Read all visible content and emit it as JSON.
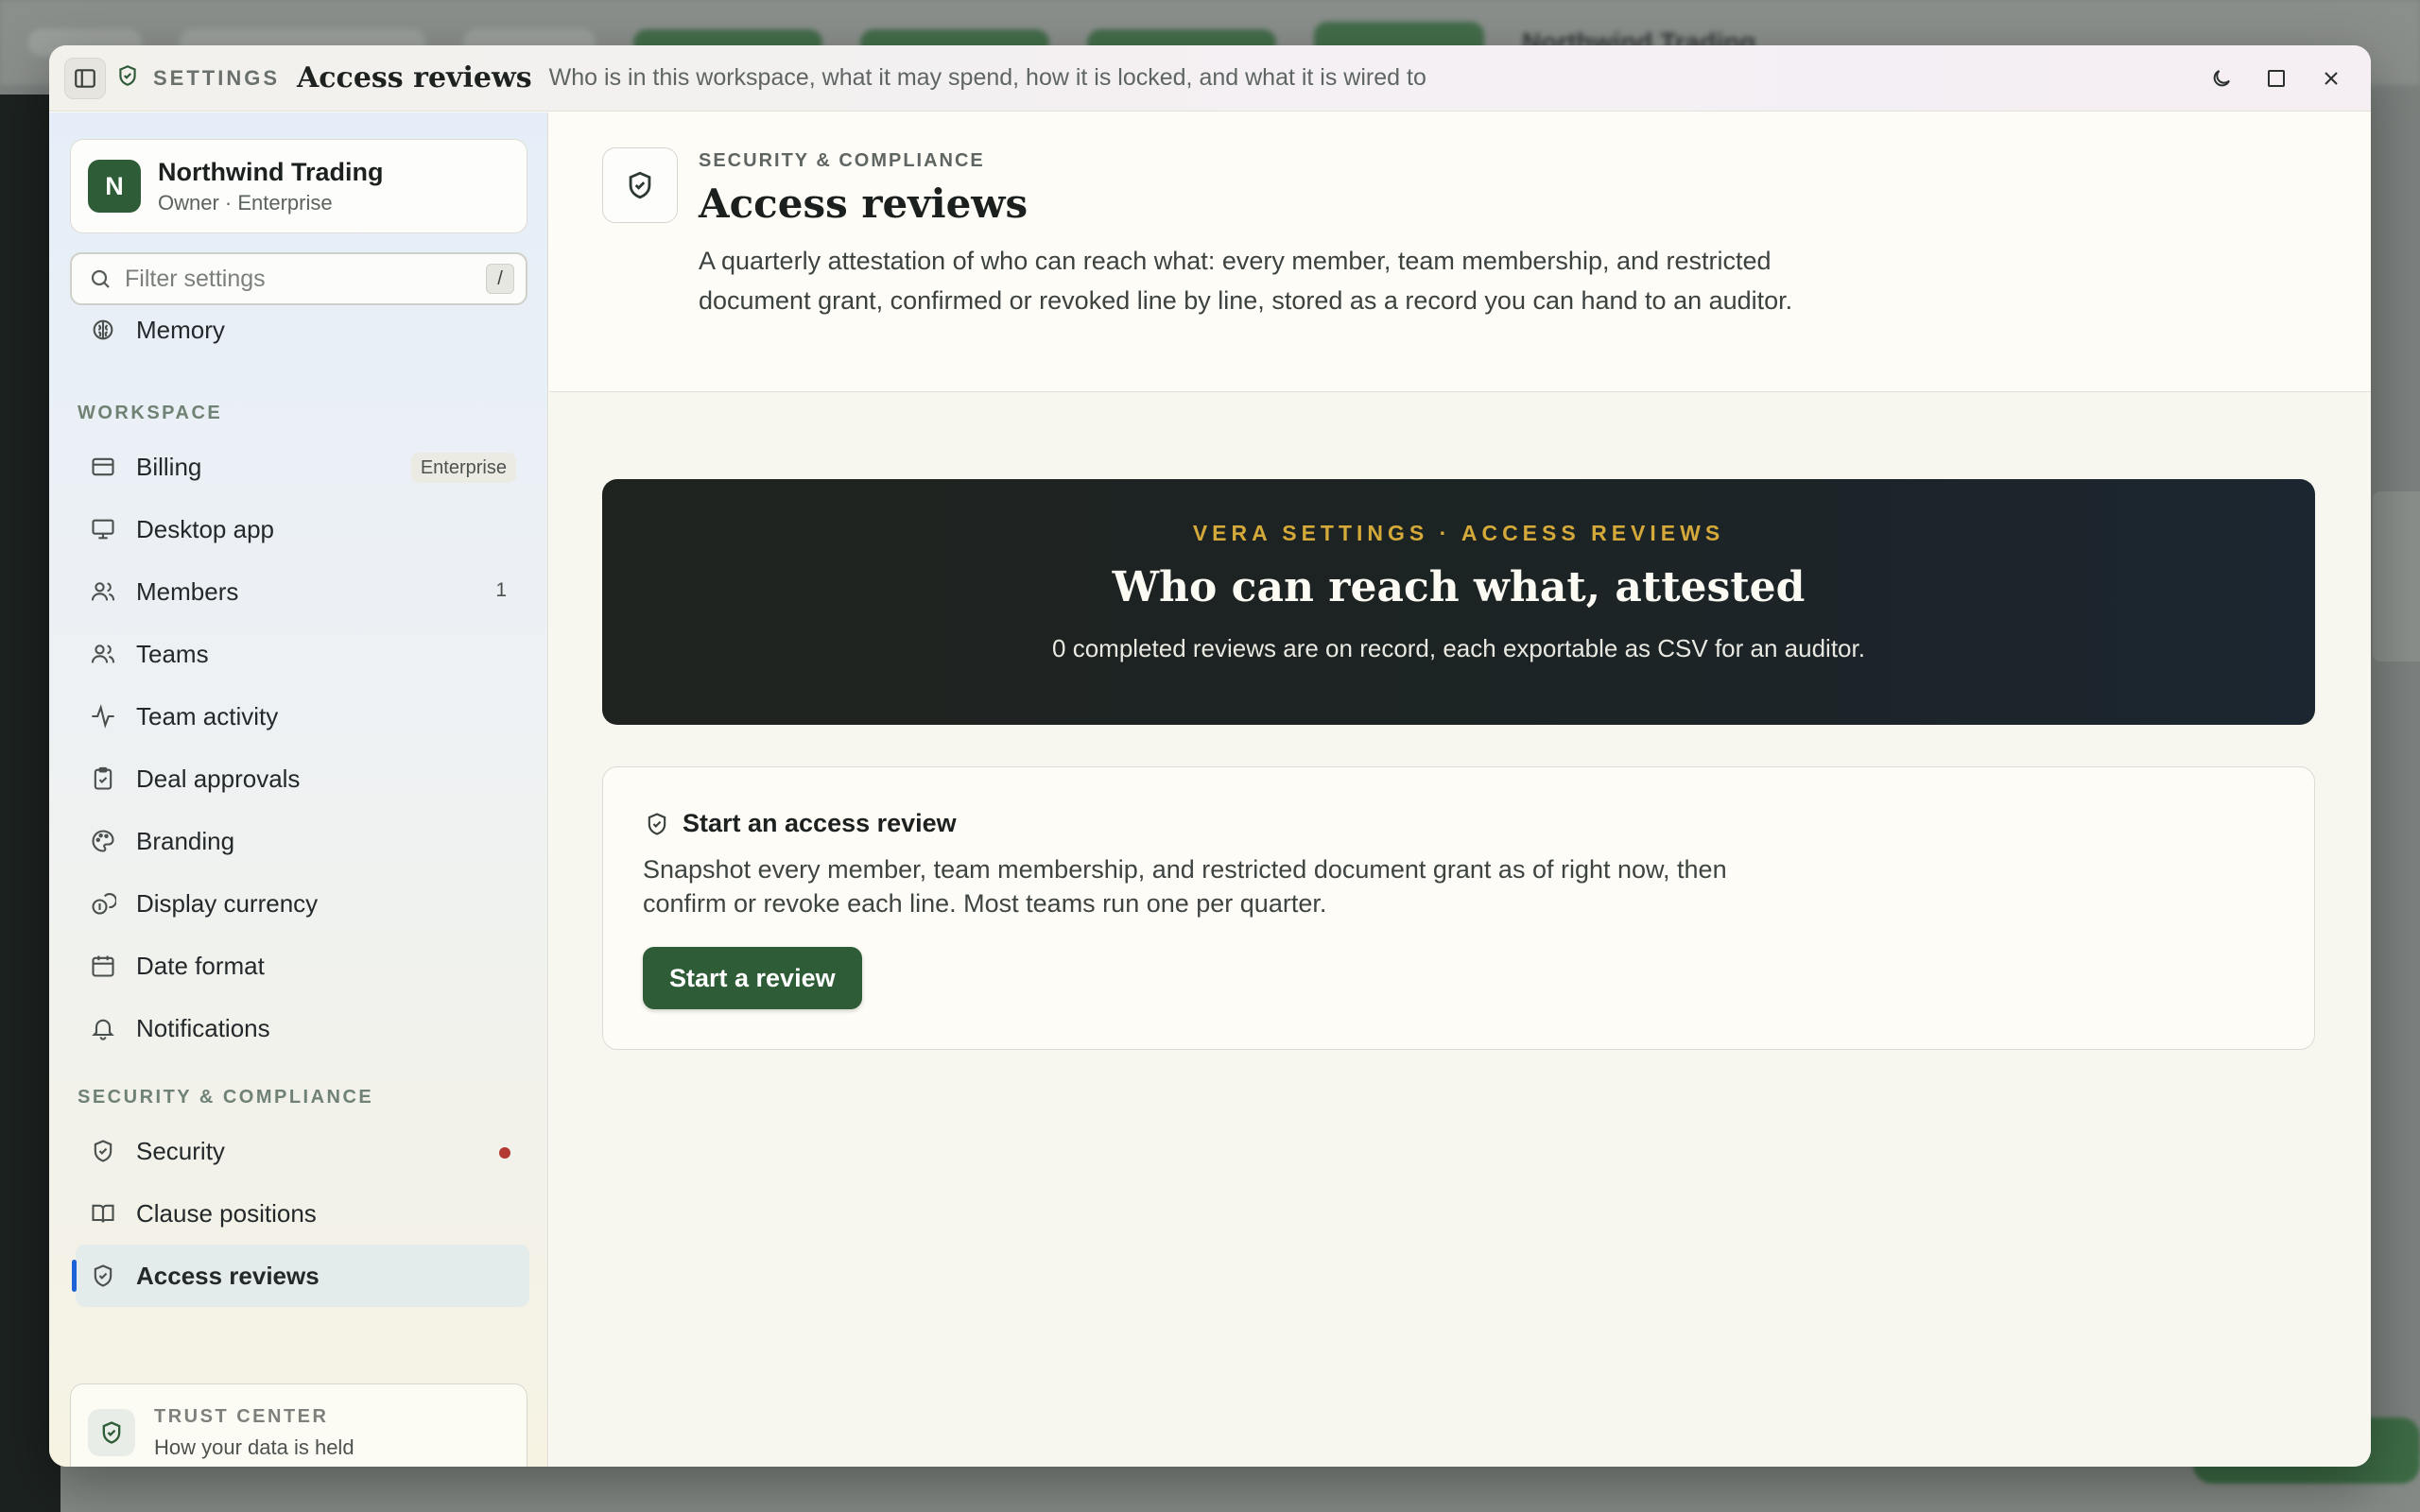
{
  "background_app": {
    "org_name": "Northwind Trading"
  },
  "titlebar": {
    "section": "SETTINGS",
    "title": "Access reviews",
    "subtitle": "Who is in this workspace, what it may spend, how it is locked, and what it is wired to",
    "icons": [
      "sidebar-toggle-icon",
      "shield-check-icon",
      "moon-icon",
      "maximize-icon",
      "close-icon"
    ]
  },
  "sidebar": {
    "org": {
      "initial": "N",
      "name": "Northwind Trading",
      "role": "Owner · Enterprise",
      "avatar_color": "#2e5c37"
    },
    "filter": {
      "placeholder": "Filter settings",
      "shortcut": "/"
    },
    "items_top": [
      {
        "label": "Memory",
        "icon": "brain-icon"
      }
    ],
    "sections": [
      {
        "title": "WORKSPACE",
        "items": [
          {
            "label": "Billing",
            "icon": "credit-card-icon",
            "badge": "Enterprise"
          },
          {
            "label": "Desktop app",
            "icon": "monitor-icon"
          },
          {
            "label": "Members",
            "icon": "users-icon",
            "count": "1"
          },
          {
            "label": "Teams",
            "icon": "users-icon"
          },
          {
            "label": "Team activity",
            "icon": "activity-icon"
          },
          {
            "label": "Deal approvals",
            "icon": "clipboard-check-icon"
          },
          {
            "label": "Branding",
            "icon": "palette-icon"
          },
          {
            "label": "Display currency",
            "icon": "coins-icon"
          },
          {
            "label": "Date format",
            "icon": "calendar-icon"
          },
          {
            "label": "Notifications",
            "icon": "bell-icon"
          }
        ]
      },
      {
        "title": "SECURITY & COMPLIANCE",
        "items": [
          {
            "label": "Security",
            "icon": "shield-icon",
            "alert_dot": true
          },
          {
            "label": "Clause positions",
            "icon": "book-open-icon"
          },
          {
            "label": "Access reviews",
            "icon": "shield-check-icon",
            "active": true
          }
        ]
      }
    ],
    "trust_center": {
      "title": "TRUST CENTER",
      "subtitle": "How your data is held"
    }
  },
  "main": {
    "header": {
      "eyebrow": "SECURITY & COMPLIANCE",
      "title": "Access reviews",
      "description": "A quarterly attestation of who can reach what: every member, team membership, and restricted document grant, confirmed or revoked line by line, stored as a record you can hand to an auditor."
    },
    "hero": {
      "eyebrow": "VERA SETTINGS · ACCESS REVIEWS",
      "title": "Who can reach what, attested",
      "subtitle": "0 completed reviews are on record, each exportable as CSV for an auditor."
    },
    "start_card": {
      "title": "Start an access review",
      "description": "Snapshot every member, team membership, and restricted document grant as of right now, then confirm or revoke each line. Most teams run one per quarter.",
      "button_label": "Start a review"
    }
  },
  "colors": {
    "accent_green": "#2e5c37",
    "hero_gold": "#d4a93a",
    "active_indicator": "#1e62d8",
    "alert_dot": "#b23a32"
  }
}
